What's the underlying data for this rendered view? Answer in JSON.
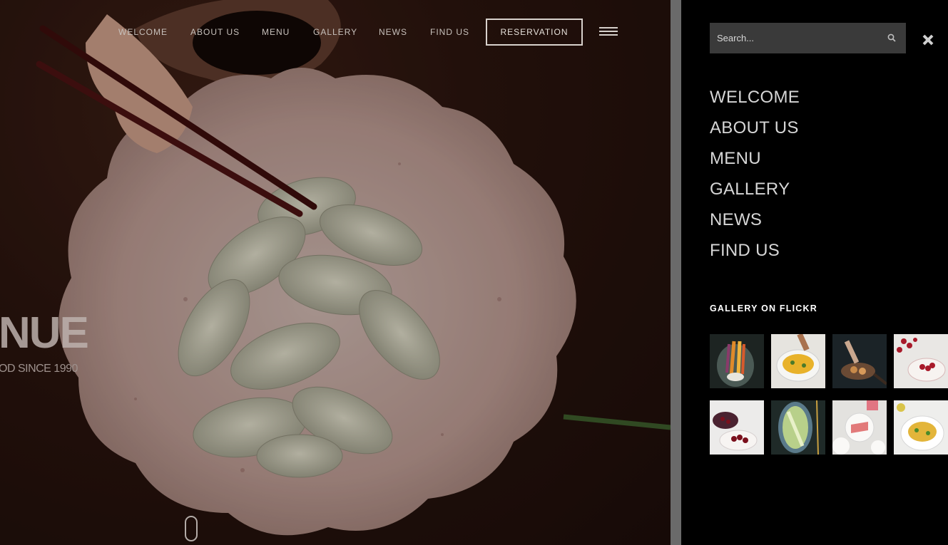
{
  "top_nav": {
    "items": [
      "WELCOME",
      "ABOUT US",
      "MENU",
      "GALLERY",
      "NEWS",
      "FIND US"
    ],
    "reservation_label": "RESERVATION"
  },
  "hero": {
    "title": "NUE",
    "subtitle": "OD SINCE 1990"
  },
  "side_panel": {
    "search_placeholder": "Search...",
    "menu": [
      "WELCOME",
      "ABOUT US",
      "MENU",
      "GALLERY",
      "NEWS",
      "FIND US"
    ],
    "flickr_title": "GALLERY ON FLICKR",
    "thumbnails": [
      "vegetables-thumb",
      "bowl-salad-thumb",
      "pan-cooking-thumb",
      "cherries-thumb",
      "cherries-bowl-thumb",
      "green-salad-thumb",
      "sliced-fruit-thumb",
      "pasta-thumb"
    ]
  },
  "colors": {
    "panel_bg": "#000000",
    "divider": "#6a6a6a",
    "search_bg": "#3a3a3a",
    "hero_bg": "#2a140e"
  }
}
